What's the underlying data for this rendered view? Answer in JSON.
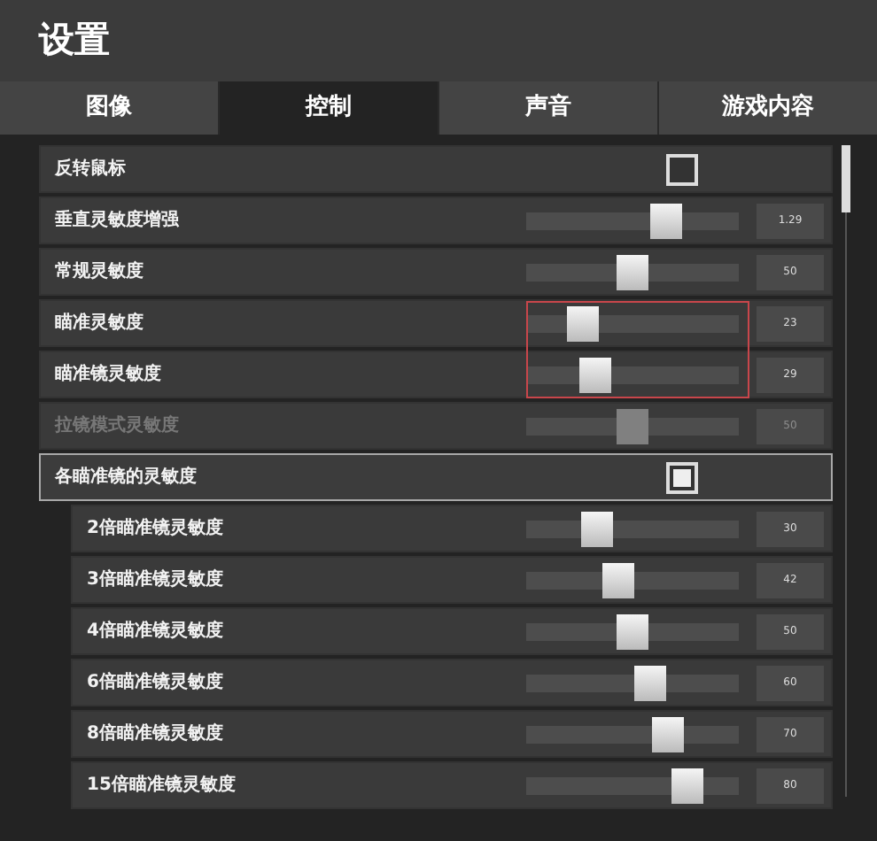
{
  "window": {
    "title": "设置"
  },
  "tabs": [
    {
      "label": "图像",
      "selected": false
    },
    {
      "label": "控制",
      "selected": true
    },
    {
      "label": "声音",
      "selected": false
    },
    {
      "label": "游戏内容",
      "selected": false
    }
  ],
  "settings": [
    {
      "kind": "checkbox",
      "label": "反转鼠标",
      "checked": false,
      "disabled": false,
      "selected": false
    },
    {
      "kind": "slider",
      "label": "垂直灵敏度增强",
      "level": 0.69,
      "reading": "1.29",
      "disabled": false,
      "highlighted": false
    },
    {
      "kind": "slider",
      "label": "常规灵敏度",
      "level": 0.5,
      "reading": "50",
      "disabled": false,
      "highlighted": false
    },
    {
      "kind": "slider",
      "label": "瞄准灵敏度",
      "level": 0.23,
      "reading": "23",
      "disabled": false,
      "highlighted": true
    },
    {
      "kind": "slider",
      "label": "瞄准镜灵敏度",
      "level": 0.29,
      "reading": "29",
      "disabled": false,
      "highlighted": true
    },
    {
      "kind": "slider",
      "label": "拉镜模式灵敏度",
      "level": 0.5,
      "reading": "50",
      "disabled": true,
      "highlighted": false
    },
    {
      "kind": "checkbox",
      "label": "各瞄准镜的灵敏度",
      "checked": true,
      "disabled": false,
      "selected": true,
      "children": [
        {
          "kind": "slider",
          "label": "2倍瞄准镜灵敏度",
          "level": 0.3,
          "reading": "30",
          "disabled": false,
          "highlighted": false
        },
        {
          "kind": "slider",
          "label": "3倍瞄准镜灵敏度",
          "level": 0.42,
          "reading": "42",
          "disabled": false,
          "highlighted": false
        },
        {
          "kind": "slider",
          "label": "4倍瞄准镜灵敏度",
          "level": 0.5,
          "reading": "50",
          "disabled": false,
          "highlighted": false
        },
        {
          "kind": "slider",
          "label": "6倍瞄准镜灵敏度",
          "level": 0.6,
          "reading": "60",
          "disabled": false,
          "highlighted": false
        },
        {
          "kind": "slider",
          "label": "8倍瞄准镜灵敏度",
          "level": 0.7,
          "reading": "70",
          "disabled": false,
          "highlighted": false
        },
        {
          "kind": "slider",
          "label": "15倍瞄准镜灵敏度",
          "level": 0.8,
          "reading": "80",
          "disabled": false,
          "highlighted": false
        }
      ]
    }
  ]
}
